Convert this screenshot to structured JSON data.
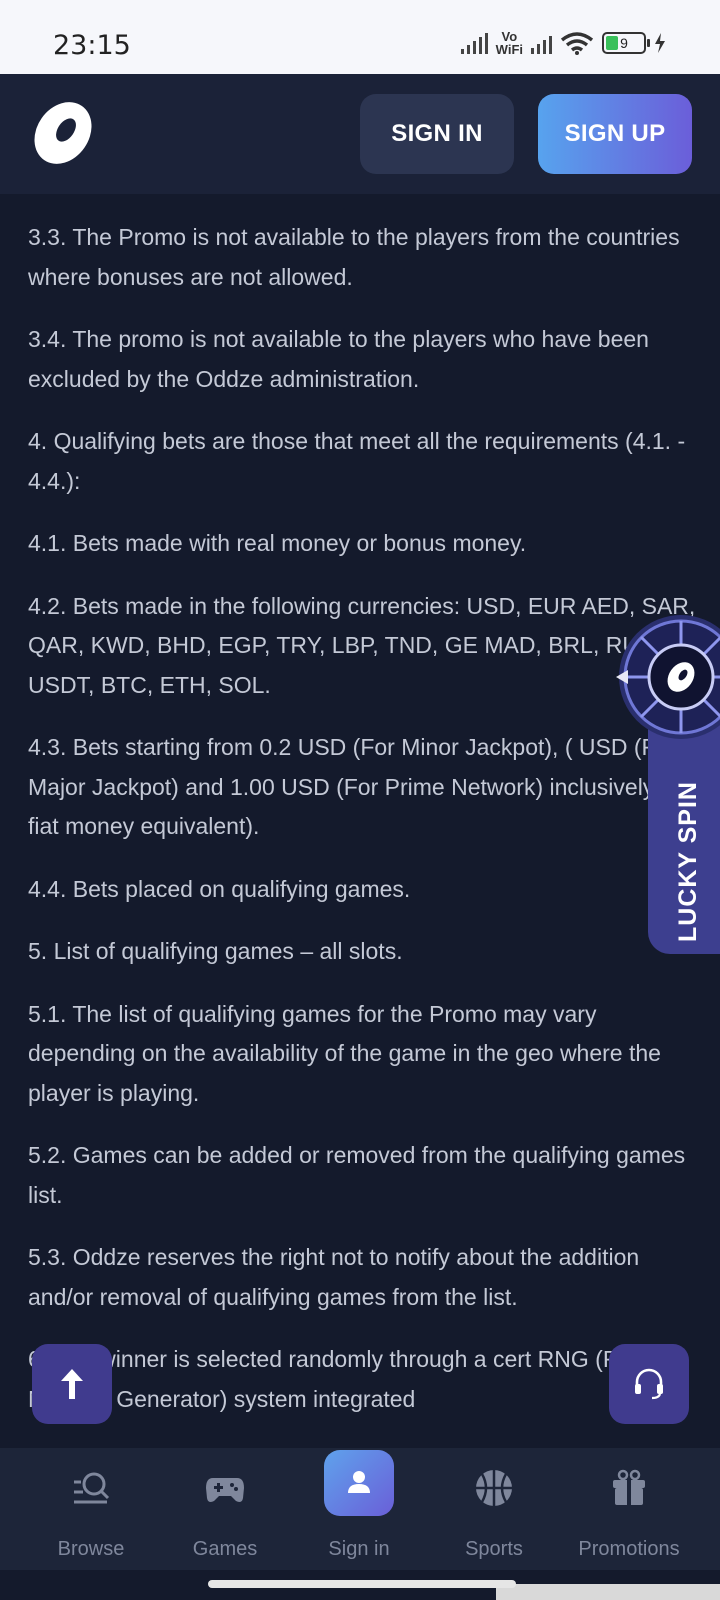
{
  "status_bar": {
    "time": "23:15",
    "vowifi_line1": "Vo",
    "vowifi_line2": "WiFi",
    "battery_level": "9"
  },
  "header": {
    "sign_in": "SIGN IN",
    "sign_up": "SIGN UP"
  },
  "content": {
    "paragraphs": [
      "3.3. The Promo is not available to the players from the countries where bonuses are not allowed.",
      "3.4. The promo is not available to the players who have been excluded by the Oddze administration.",
      "4. Qualifying bets are those that meet all the requirements (4.1. - 4.4.):",
      "4.1. Bets made with real money or bonus money.",
      "4.2. Bets made in the following currencies: USD, EUR AED, SAR, QAR, KWD, BHD, EGP, TRY, LBP, TND, GE MAD, BRL, RUB, USDT, BTC, ETH, SOL.",
      "4.3. Bets starting from 0.2 USD (For Minor Jackpot), ( USD (For Major Jackpot) and 1.00 USD (For Prime Network) inclusively (or fiat money equivalent).",
      "4.4. Bets placed on qualifying games.",
      "5. List of qualifying games – all slots.",
      "5.1. The list of qualifying games for the Promo may vary depending on the availability of the game in the geo where the player is playing.",
      "5.2. Games can be added or removed from the qualifying games list.",
      "5.3. Oddze reserves the right not to notify about the addition and/or removal of qualifying games from the list.",
      "6. The winner is selected randomly through a cert RNG (Random Number Generator) system integrated"
    ]
  },
  "lucky_spin": {
    "label": "LUCKY SPIN"
  },
  "bottom_nav": {
    "items": [
      {
        "label": "Browse",
        "icon": "search-icon"
      },
      {
        "label": "Games",
        "icon": "gamepad-icon"
      },
      {
        "label": "Sign in",
        "icon": "user-icon"
      },
      {
        "label": "Sports",
        "icon": "basketball-icon"
      },
      {
        "label": "Promotions",
        "icon": "gift-icon"
      }
    ]
  },
  "colors": {
    "background": "#141a2c",
    "header": "#1b2238",
    "accent_blue": "#57a3ee",
    "accent_purple": "#6b5ed9",
    "fab": "#403b8e"
  }
}
